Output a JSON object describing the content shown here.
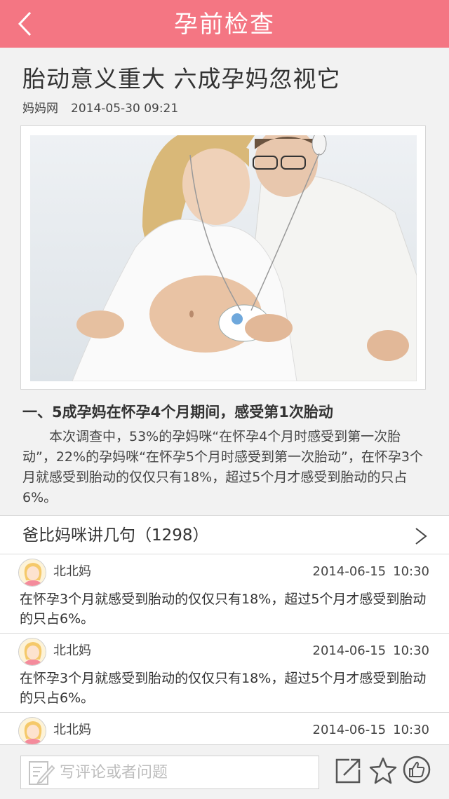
{
  "header": {
    "title": "孕前检查",
    "back_icon": "chevron-left-icon",
    "background_color": "#f47683"
  },
  "article": {
    "title": "胎动意义重大  六成孕妈忽视它",
    "source": "妈妈网",
    "datetime": "2014-05-30 09:21",
    "image_alt": "孕妇与丈夫用胎心仪听胎动",
    "section_heading": "一、5成孕妈在怀孕4个月期间，感受第1次胎动",
    "body": "本次调查中，53%的孕妈咪“在怀孕4个月时感受到第一次胎动”，22%的孕妈咪“在怀孕5个月时感受到第一次胎动”，在怀孕3个月就感受到胎动的仅仅只有18%，超过5个月才感受到胎动的只占6%。"
  },
  "comments": {
    "header_label": "爸比妈咪讲几句（1298）",
    "arrow_icon": "chevron-right-icon",
    "items": [
      {
        "user": "北北妈",
        "date": "2014-06-15",
        "time": "10:30",
        "text": "在怀孕3个月就感受到胎动的仅仅只有18%，超过5个月才感受到胎动的只占6%。"
      },
      {
        "user": "北北妈",
        "date": "2014-06-15",
        "time": "10:30",
        "text": "在怀孕3个月就感受到胎动的仅仅只有18%，超过5个月才感受到胎动的只占6%。"
      },
      {
        "user": "北北妈",
        "date": "2014-06-15",
        "time": "10:30",
        "text": ""
      }
    ]
  },
  "bottom_bar": {
    "input_placeholder": "写评论或者问题",
    "icons": [
      "edit-icon",
      "share-icon",
      "star-icon",
      "thumbs-up-icon"
    ]
  }
}
